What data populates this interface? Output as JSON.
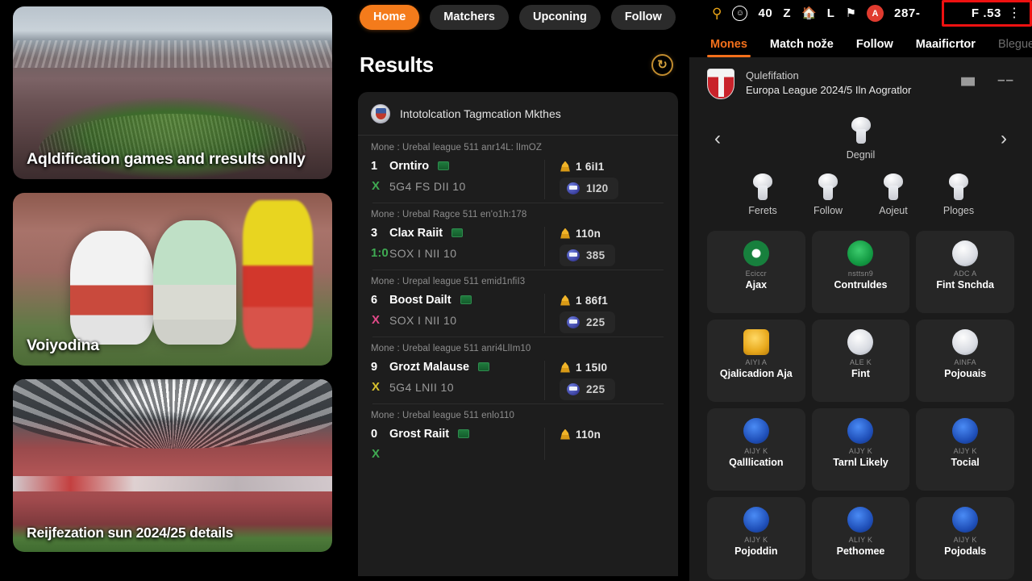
{
  "left_panel": {
    "cards": [
      {
        "caption": "Aqldification games and rresults onlly",
        "image": "stadium-bowl-overcast"
      },
      {
        "caption": "Voiyodina",
        "image": "football-players-action"
      },
      {
        "caption": "Reijfezation sun 2024/25 details",
        "image": "domed-stadium-crowd"
      }
    ]
  },
  "center_panel": {
    "tabs": [
      {
        "label": "Home",
        "active": true
      },
      {
        "label": "Matchers",
        "active": false
      },
      {
        "label": "Upconing",
        "active": false
      },
      {
        "label": "Follow",
        "active": false
      }
    ],
    "section_title": "Results",
    "refresh_icon": "refresh-circle-icon",
    "panel_header": {
      "icon": "club-crest-icon",
      "title": "Intotolcation Tagmcation Mkthes"
    },
    "matches": [
      {
        "league": "Mone : Urebal league 511 anr14L: lImOZ",
        "rank": "1",
        "team": "Orntiro",
        "flag": "green-flag-icon",
        "mark": "X",
        "mark_color": "green",
        "score": "5G4 FS DII 10",
        "stat_trophy": "1 6iI1",
        "stat_badge": "1I20"
      },
      {
        "league": "Mone : Urebal Ragce 511 en'o1h:178",
        "rank": "3",
        "team": "Clax Raiit",
        "flag": "green-flag-icon",
        "mark": "1:0",
        "mark_color": "green",
        "score": "SOX I NII 10",
        "stat_trophy": "110n",
        "stat_badge": "385"
      },
      {
        "league": "Mone : Urepal league 511 emid1nfiI3",
        "rank": "6",
        "team": "Boost Dailt",
        "flag": "green-flag-icon",
        "mark": "X",
        "mark_color": "pink",
        "score": "SOX I NII 10",
        "stat_trophy": "1 86f1",
        "stat_badge": "225"
      },
      {
        "league": "Mone : Urebal league 511 anri4LlIm10",
        "rank": "9",
        "team": "Grozt Malause",
        "flag": "green-flag-icon",
        "mark": "X",
        "mark_color": "yellow",
        "score": "5G4 LNII 10",
        "stat_trophy": "1 15I0",
        "stat_badge": "225"
      },
      {
        "league": "Mone : Urebal league 511 enlo110",
        "rank": "0",
        "team": "Grost Raiit",
        "flag": "green-flag-icon",
        "mark": "X",
        "mark_color": "green",
        "score": "",
        "stat_trophy": "110n",
        "stat_badge": ""
      }
    ]
  },
  "right_panel": {
    "status_bar": {
      "icons": [
        "bird-icon",
        "circle-person-icon",
        "home-icon",
        "letter-l-icon",
        "flag-icon",
        "red-badge-icon",
        "kebab-menu-icon"
      ],
      "text_items": [
        "40",
        "Z",
        "L",
        "287-"
      ],
      "clock": "F .53",
      "red_badge": "A",
      "highlight_color": "#ee1111"
    },
    "tabs": [
      {
        "label": "Mones",
        "active": true,
        "muted": false
      },
      {
        "label": "Match nože",
        "active": false,
        "muted": false
      },
      {
        "label": "Follow",
        "active": false,
        "muted": false
      },
      {
        "label": "Maaificrtor",
        "active": false,
        "muted": false
      },
      {
        "label": "Blegued",
        "active": false,
        "muted": true
      }
    ],
    "competition": {
      "crest": "club-crest-icon",
      "line1": "Qulefifation",
      "line2": "Europa League 2024/5 Iln Aogratlor",
      "gift_icon": "gift-icon",
      "more_icon": "dashes-icon"
    },
    "carousel": {
      "prev_icon": "chevron-left-icon",
      "next_icon": "chevron-right-icon",
      "center_label": "Degnil",
      "center_icon": "pin-icon"
    },
    "quick_actions": [
      {
        "label": "Ferets",
        "icon": "pin-icon"
      },
      {
        "label": "Follow",
        "icon": "pin-icon"
      },
      {
        "label": "Aojeut",
        "icon": "pin-icon"
      },
      {
        "label": "Ploges",
        "icon": "pin-icon"
      }
    ],
    "team_grid": [
      {
        "logo": "green-ring",
        "sub": "Eciccr",
        "name": "Ajax"
      },
      {
        "logo": "green-solid",
        "sub": "nsttsn9",
        "name": "Contruldes"
      },
      {
        "logo": "silver",
        "sub": "ADC A",
        "name": "Fint Snchda"
      },
      {
        "logo": "gold",
        "sub": "AIYI A",
        "name": "Qjalicadion Aja"
      },
      {
        "logo": "silver",
        "sub": "ALE K",
        "name": "Fint"
      },
      {
        "logo": "silver",
        "sub": "AINFA",
        "name": "Pojouais"
      },
      {
        "logo": "blue",
        "sub": "AIJY K",
        "name": "Qalllication"
      },
      {
        "logo": "blue",
        "sub": "AIJY K",
        "name": "Tarnl Likely"
      },
      {
        "logo": "blue",
        "sub": "AIJY K",
        "name": "Tocial"
      },
      {
        "logo": "blue",
        "sub": "AIJY K",
        "name": "Pojoddin"
      },
      {
        "logo": "blue",
        "sub": "ALIY K",
        "name": "Pethomee"
      },
      {
        "logo": "blue",
        "sub": "AIJY K",
        "name": "Pojodals"
      }
    ]
  }
}
